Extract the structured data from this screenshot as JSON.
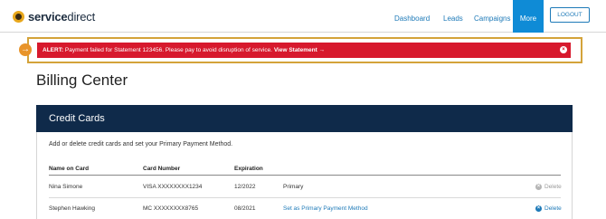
{
  "brand": {
    "name_bold": "service",
    "name_light": "direct"
  },
  "nav": {
    "links": [
      "Dashboard",
      "Leads",
      "Campaigns"
    ],
    "more": "More",
    "logout": "LOGOUT"
  },
  "alert": {
    "label": "ALERT:",
    "message": " Payment failed for Statement 123456. Please pay to avoid disruption of service. ",
    "action": "View Statement →",
    "close": "×",
    "arrow": "→"
  },
  "page": {
    "title": "Billing Center"
  },
  "credit_cards": {
    "header": "Credit Cards",
    "description": "Add or delete credit cards and set your Primary Payment Method.",
    "columns": [
      "Name on Card",
      "Card Number",
      "Expiration"
    ],
    "rows": [
      {
        "name": "Nina Simone",
        "number": "VISA XXXXXXXX1234",
        "expiration": "12/2022",
        "status": "Primary",
        "delete": "Delete"
      },
      {
        "name": "Stephen Hawking",
        "number": "MC XXXXXXXX8765",
        "expiration": "08/2021",
        "status": "Set as Primary Payment Method",
        "delete": "Delete"
      }
    ]
  },
  "colors": {
    "nav_active": "#0f8bd6",
    "alert_bg": "#d7192d",
    "card_header": "#0f2a4a",
    "link": "#1e7ab8"
  }
}
